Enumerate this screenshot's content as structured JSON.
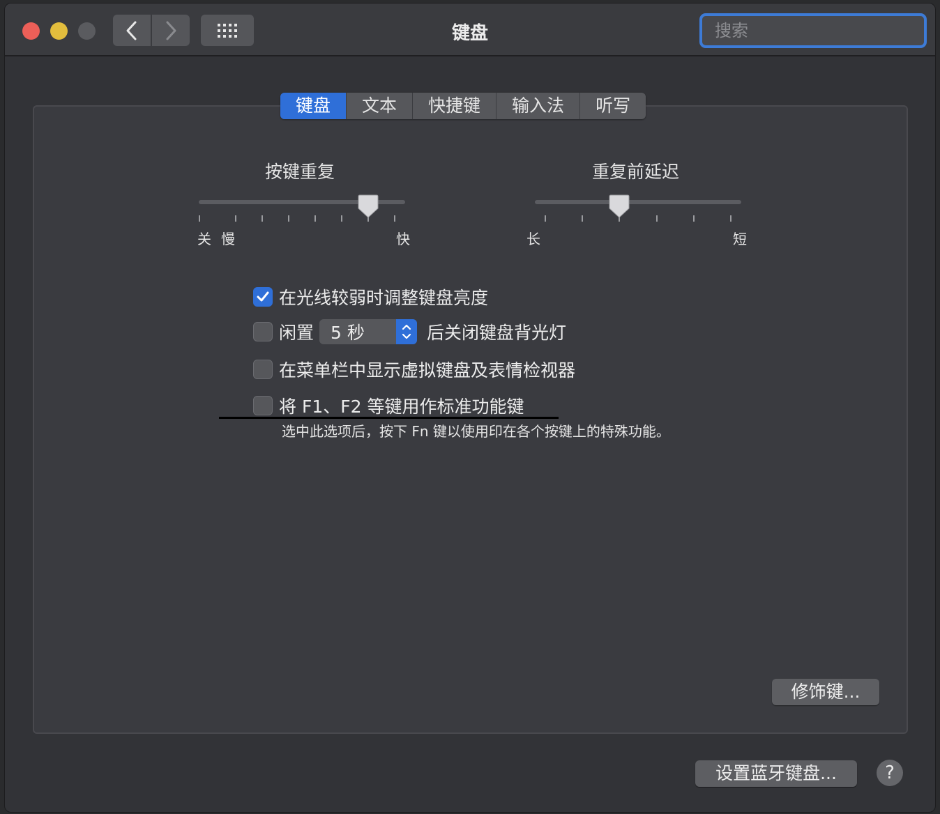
{
  "window": {
    "title": "键盘"
  },
  "search": {
    "placeholder": "搜索"
  },
  "icons": {
    "back": "chevron-left-icon",
    "forward": "chevron-right-icon",
    "grid": "grid-icon",
    "search": "magnifier-icon",
    "check": "checkmark-icon",
    "stepper": "up-down-chevron-icon"
  },
  "tabs": [
    "键盘",
    "文本",
    "快捷键",
    "输入法",
    "听写"
  ],
  "active_tab": "键盘",
  "key_repeat": {
    "title": "按键重复",
    "label_off": "关",
    "label_slow": "慢",
    "label_fast": "快",
    "value_fraction": 0.82
  },
  "repeat_delay": {
    "title": "重复前延迟",
    "label_long": "长",
    "label_short": "短",
    "value_fraction": 0.41
  },
  "options": {
    "adjust_brightness": {
      "label": "在光线较弱时调整键盘亮度",
      "checked": true
    },
    "backlight_off": {
      "prefix": "闲置",
      "value": "5 秒",
      "suffix": "后关闭键盘背光灯",
      "checked": false
    },
    "show_viewer": {
      "label": "在菜单栏中显示虚拟键盘及表情检视器",
      "checked": false
    },
    "fn_keys": {
      "label": "将 F1、F2 等键用作标准功能键",
      "checked": false,
      "hint": "选中此选项后，按下 Fn 键以使用印在各个按键上的特殊功能。"
    }
  },
  "buttons": {
    "modifier": "修饰键...",
    "bluetooth": "设置蓝牙键盘...",
    "help": "?"
  },
  "colors": {
    "accent": "#2f6fd8",
    "close": "#ec5f58",
    "minimize": "#e2bd3d"
  }
}
